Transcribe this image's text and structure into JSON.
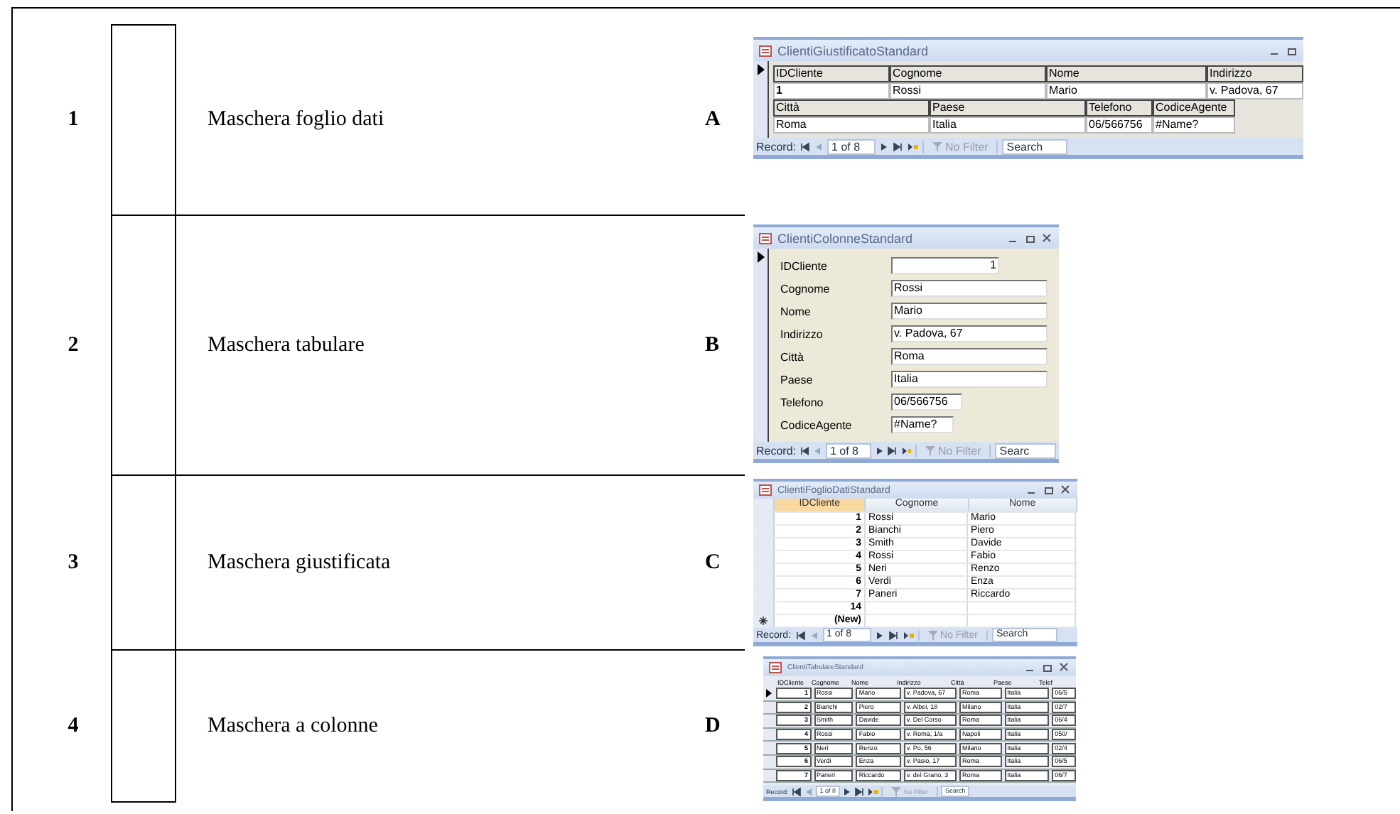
{
  "exercise": {
    "rows": [
      {
        "number": "1",
        "label": "Maschera foglio dati",
        "letter": "A"
      },
      {
        "number": "2",
        "label": "Maschera tabulare",
        "letter": "B"
      },
      {
        "number": "3",
        "label": "Maschera giustificata",
        "letter": "C"
      },
      {
        "number": "4",
        "label": "Maschera a colonne",
        "letter": "D"
      }
    ]
  },
  "screenshots": [
    {
      "kind": "justified",
      "title": "ClientiGiustificatoStandard",
      "lines": [
        [
          {
            "label": "IDCliente",
            "value": "1"
          },
          {
            "label": "Cognome",
            "value": "Rossi"
          },
          {
            "label": "Nome",
            "value": "Mario"
          },
          {
            "label": "Indirizzo",
            "value": "v. Padova, 67"
          }
        ],
        [
          {
            "label": "Città",
            "value": "Roma"
          },
          {
            "label": "Paese",
            "value": "Italia"
          },
          {
            "label": "Telefono",
            "value": "06/566756"
          },
          {
            "label": "CodiceAgente",
            "value": "#Name?"
          }
        ]
      ],
      "nav": {
        "label": "Record:",
        "position": "1 of 8",
        "filter": "No Filter",
        "search": "Search"
      }
    },
    {
      "kind": "columnar",
      "title": "ClientiColonneStandard",
      "fields": [
        {
          "label": "IDCliente",
          "value": "1"
        },
        {
          "label": "Cognome",
          "value": "Rossi"
        },
        {
          "label": "Nome",
          "value": "Mario"
        },
        {
          "label": "Indirizzo",
          "value": "v. Padova, 67"
        },
        {
          "label": "Città",
          "value": "Roma"
        },
        {
          "label": "Paese",
          "value": "Italia"
        },
        {
          "label": "Telefono",
          "value": "06/566756"
        },
        {
          "label": "CodiceAgente",
          "value": "#Name?"
        }
      ],
      "nav": {
        "label": "Record:",
        "position": "1 of 8",
        "filter": "No Filter",
        "search": "Searc"
      }
    },
    {
      "kind": "datasheet",
      "title": "ClientiFoglioDatiStandard",
      "columns": [
        "IDCliente",
        "Cognome",
        "Nome"
      ],
      "rows": [
        [
          "1",
          "Rossi",
          "Mario"
        ],
        [
          "2",
          "Bianchi",
          "Piero"
        ],
        [
          "3",
          "Smith",
          "Davide"
        ],
        [
          "4",
          "Rossi",
          "Fabio"
        ],
        [
          "5",
          "Neri",
          "Renzo"
        ],
        [
          "6",
          "Verdi",
          "Enza"
        ],
        [
          "7",
          "Paneri",
          "Riccardo"
        ],
        [
          "14",
          "",
          ""
        ]
      ],
      "new_row": "(New)",
      "nav": {
        "label": "Record:",
        "position": "1 of 8",
        "filter": "No Filter",
        "search": "Search"
      }
    },
    {
      "kind": "tabular",
      "title": "ClientiTabulareStandard",
      "columns": [
        "IDCliente",
        "Cognome",
        "Nome",
        "Indirizzo",
        "Città",
        "Paese",
        "Telef"
      ],
      "rows": [
        [
          "1",
          "Rossi",
          "Mario",
          "v. Padova, 67",
          "Roma",
          "Italia",
          "06/5"
        ],
        [
          "2",
          "Bianchi",
          "Piero",
          "v. Albei, 18",
          "Milano",
          "Italia",
          "02/7"
        ],
        [
          "3",
          "Smith",
          "Davide",
          "v. Del Corso",
          "Roma",
          "Italia",
          "06/4"
        ],
        [
          "4",
          "Rossi",
          "Fabio",
          "v. Roma, 1/a",
          "Napoli",
          "Italia",
          "050/"
        ],
        [
          "5",
          "Neri",
          "Renzo",
          "v. Po, 56",
          "Milano",
          "Italia",
          "02/4"
        ],
        [
          "6",
          "Verdi",
          "Enza",
          "v. Pasio, 17",
          "Roma",
          "Italia",
          "06/5"
        ],
        [
          "7",
          "Paneri",
          "Riccardo",
          "v. del Grano, 3",
          "Roma",
          "Italia",
          "06/7"
        ]
      ],
      "nav": {
        "label": "Record:",
        "position": "1 of 8",
        "filter": "No Filter",
        "search": "Search"
      }
    }
  ]
}
